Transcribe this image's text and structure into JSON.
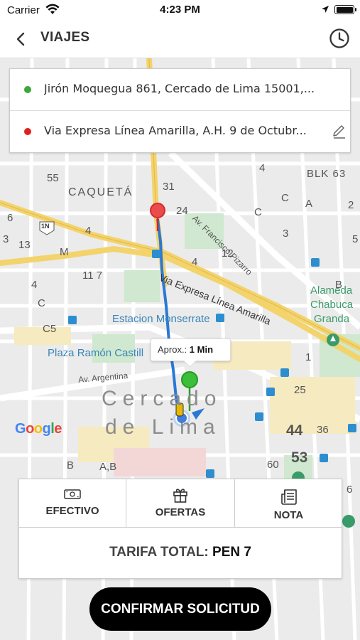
{
  "status_bar": {
    "carrier": "Carrier",
    "time": "4:23 PM",
    "battery_level": 1.0
  },
  "nav": {
    "title": "VIAJES",
    "back_icon": "chevron-left-icon",
    "history_icon": "clock-icon"
  },
  "route": {
    "origin": "Jirón Moquegua 861, Cercado de Lima 15001,...",
    "destination": "Via Expresa Línea Amarilla, A.H. 9 de Octubr...",
    "origin_color": "#3aa83a",
    "destination_color": "#e02020"
  },
  "map": {
    "eta_label": "Aprox.:",
    "eta_value": "1 Min",
    "attribution": "Google",
    "labels": {
      "caqueta": "CAQUETÁ",
      "av_pizarro": "Av. Francisco Pizarro",
      "via_expresa": "Via Expresa Línea Amarilla",
      "estacion": "Estacion Monserrate",
      "plaza": "Plaza Ramón Castill",
      "av_argentina": "Av. Argentina",
      "cercado": "Cercado",
      "de_lima": "de Lima",
      "alameda": "Alameda",
      "chabuca": "Chabuca",
      "granda": "Granda",
      "blk": "BLK 63",
      "shield": "1N",
      "ab": "A,B",
      "n55": "55",
      "n31": "31",
      "n24": "24",
      "n6": "6",
      "n13": "13",
      "n3": "3",
      "nM": "M",
      "n4a": "4",
      "n4b": "4",
      "n4c": "4",
      "n4d": "4",
      "n12": "12",
      "nC1": "C",
      "nC2": "C",
      "nC5": "C5",
      "nC3": "C",
      "n117": "11 7",
      "nB1": "B",
      "nB2": "B",
      "nA": "A",
      "n3b": "3",
      "n1": "1",
      "n25": "25",
      "n44": "44",
      "n36": "36",
      "n53": "53",
      "n60": "60",
      "n6b": "6",
      "n5": "5",
      "n2": "2",
      "nl": "l"
    }
  },
  "options": {
    "efectivo": "EFECTIVO",
    "ofertas": "OFERTAS",
    "nota": "NOTA",
    "efectivo_icon": "cash-icon",
    "ofertas_icon": "gift-icon",
    "nota_icon": "note-icon"
  },
  "fare": {
    "label": "TARIFA TOTAL:",
    "value": "PEN 7"
  },
  "confirm_label": "CONFIRMAR SOLICITUD",
  "colors": {
    "accent": "#000000",
    "route_line": "#2a78d6",
    "highway": "#f3d36b"
  }
}
